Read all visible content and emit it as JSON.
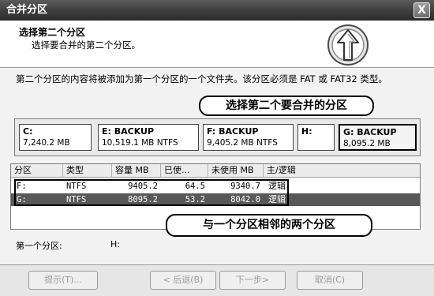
{
  "window": {
    "title": "合并分区",
    "close_glyph": "X"
  },
  "header": {
    "title": "选择第二个分区",
    "subtitle": "选择要合并的第二个分区。",
    "icon": "up-arrow-icon"
  },
  "description": "第二个分区的内容将被添加为第一个分区的一个文件夹。该分区必须是 FAT 或 FAT32 类型。",
  "callouts": {
    "top": "选择第二个要合并的分区",
    "bottom": "与一个分区相邻的两个分区"
  },
  "partition_map": [
    {
      "name": "C:",
      "detail": "7,240.2 MB"
    },
    {
      "name": "E:  BACKUP",
      "detail": "10,519.1 MB   NTFS"
    },
    {
      "name": "F:  BACKUP",
      "detail": "9,405.2 MB   NTFS"
    },
    {
      "name": "H:",
      "detail": ""
    },
    {
      "name": "G:  BACKUP",
      "detail": "8,095.2 MB"
    }
  ],
  "partition_list": {
    "columns": [
      "分区",
      "类型",
      "容量 MB",
      "已使...",
      "未使用 MB",
      "主/逻辑"
    ],
    "rows": [
      {
        "partition": "F:",
        "type": "NTFS",
        "capacity": "9405.2",
        "used": "64.5",
        "unused": "9340.7",
        "status": "逻辑"
      },
      {
        "partition": "G:",
        "type": "NTFS",
        "capacity": "8095.2",
        "used": "53.2",
        "unused": "8042.0",
        "status": "逻辑"
      }
    ]
  },
  "first_partition": {
    "label": "第一个分区:",
    "value": "H:"
  },
  "buttons": {
    "hint": "提示(T)...",
    "back": "< 后退(B)",
    "next": "下一步>",
    "cancel": "取消(C)"
  }
}
